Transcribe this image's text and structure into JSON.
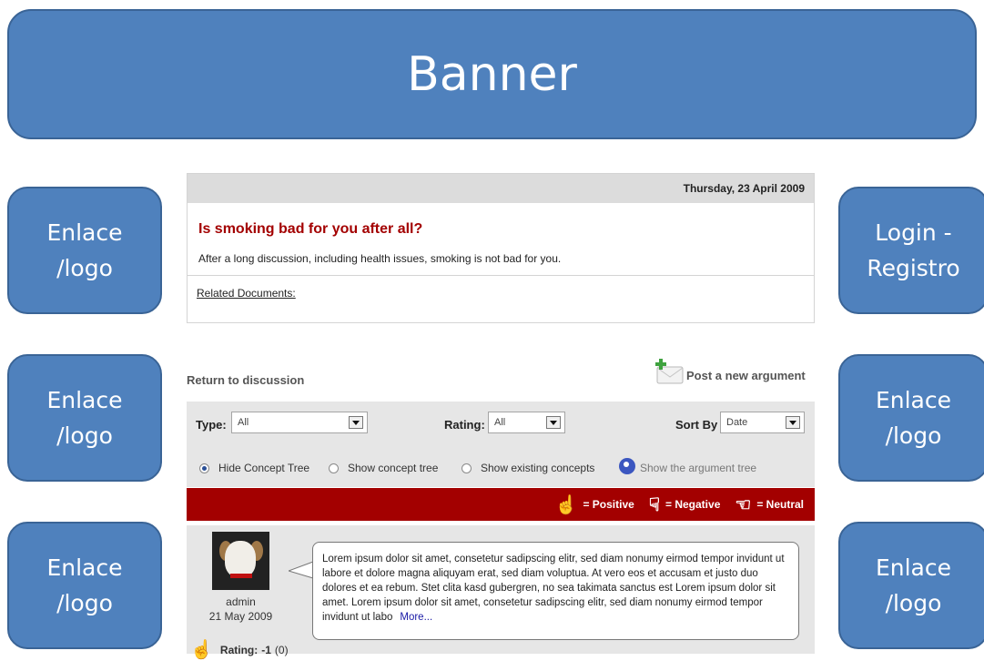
{
  "banner": {
    "label": "Banner"
  },
  "left_boxes": [
    {
      "label": "Enlace\n/logo"
    },
    {
      "label": "Enlace\n/logo"
    },
    {
      "label": "Enlace\n/logo"
    }
  ],
  "right_boxes": [
    {
      "label": "Login -\nRegistro"
    },
    {
      "label": "Enlace\n/logo"
    },
    {
      "label": "Enlace\n/logo"
    }
  ],
  "topic": {
    "date": "Thursday, 23 April 2009",
    "title": "Is smoking bad for you after all?",
    "description": "After a long discussion, including health issues, smoking is not bad for you.",
    "related_label": "Related Documents:"
  },
  "nav": {
    "return_label": "Return to discussion",
    "post_label": "Post a new argument"
  },
  "filters": {
    "type_label": "Type:",
    "type_value": "All",
    "rating_label": "Rating:",
    "rating_value": "All",
    "sort_label": "Sort By",
    "sort_value": "Date",
    "radio_options": [
      {
        "label": "Hide Concept Tree",
        "selected": true
      },
      {
        "label": "Show concept tree",
        "selected": false
      },
      {
        "label": "Show existing concepts",
        "selected": false
      }
    ],
    "argument_tree_label": "Show the argument tree"
  },
  "legend": {
    "positive": "= Positive",
    "negative": "= Negative",
    "neutral": "= Neutral"
  },
  "argument": {
    "author": "admin",
    "date": "21 May 2009",
    "text": "Lorem ipsum dolor sit amet, consetetur sadipscing elitr, sed diam nonumy eirmod tempor invidunt ut labore et dolore magna aliquyam erat, sed diam voluptua. At vero eos et accusam et justo duo dolores et ea rebum. Stet clita kasd gubergren, no sea takimata sanctus est Lorem ipsum dolor sit amet. Lorem ipsum dolor sit amet, consetetur sadipscing elitr,  sed diam nonumy eirmod tempor invidunt ut labo",
    "more_label": "More...",
    "rating_label": "Rating:",
    "rating_value": "-1",
    "rating_count": "(0)"
  },
  "colors": {
    "box_blue": "#4f81bd",
    "legend_red": "#a30000",
    "title_red": "#a30000"
  }
}
